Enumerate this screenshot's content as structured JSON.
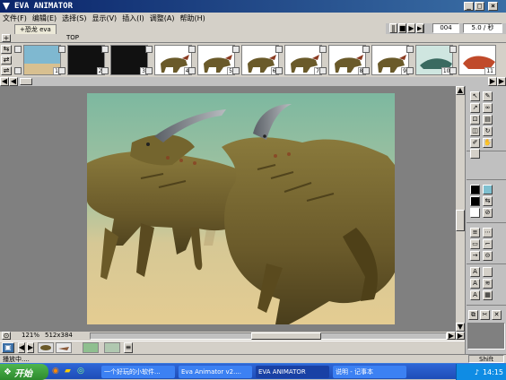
{
  "window": {
    "title": "EVA ANIMATOR"
  },
  "menu": [
    "文件(F)",
    "编辑(E)",
    "选择(S)",
    "显示(V)",
    "插入(I)",
    "调整(A)",
    "帮助(H)"
  ],
  "playback": {
    "frame_counter": "004",
    "fps": "5.0 / 秒",
    "controls": [
      "pause",
      "stop",
      "play",
      "step-forward"
    ]
  },
  "document": {
    "tab": "+恐龙 eva",
    "label": "TOP"
  },
  "frames": [
    {
      "n": "1",
      "kind": "sky"
    },
    {
      "n": "2",
      "kind": "dark"
    },
    {
      "n": "3",
      "kind": "dark"
    },
    {
      "n": "4",
      "kind": "dino"
    },
    {
      "n": "5",
      "kind": "dino"
    },
    {
      "n": "6",
      "kind": "dino"
    },
    {
      "n": "7",
      "kind": "dino"
    },
    {
      "n": "8",
      "kind": "dino"
    },
    {
      "n": "9",
      "kind": "dino"
    },
    {
      "n": "10",
      "kind": "sea"
    },
    {
      "n": "11",
      "kind": "red"
    }
  ],
  "zoom": {
    "level": "121%",
    "size": "512x384"
  },
  "status": {
    "text": "播放中....",
    "mode": "Shift"
  },
  "taskbar": {
    "start": "开始",
    "tasks": [
      {
        "label": "一个好玩的小软件...",
        "active": false
      },
      {
        "label": "Eva Animator v2....",
        "active": false
      },
      {
        "label": "EVA ANIMATOR",
        "active": true
      },
      {
        "label": "说明 - 记事本",
        "active": false
      }
    ],
    "clock": "14:15"
  },
  "colors": {
    "titlebar": "#0a246a",
    "canvas_sky": "#8ec0a0",
    "canvas_ground": "#dcc590",
    "dino": "#7a6a35"
  }
}
